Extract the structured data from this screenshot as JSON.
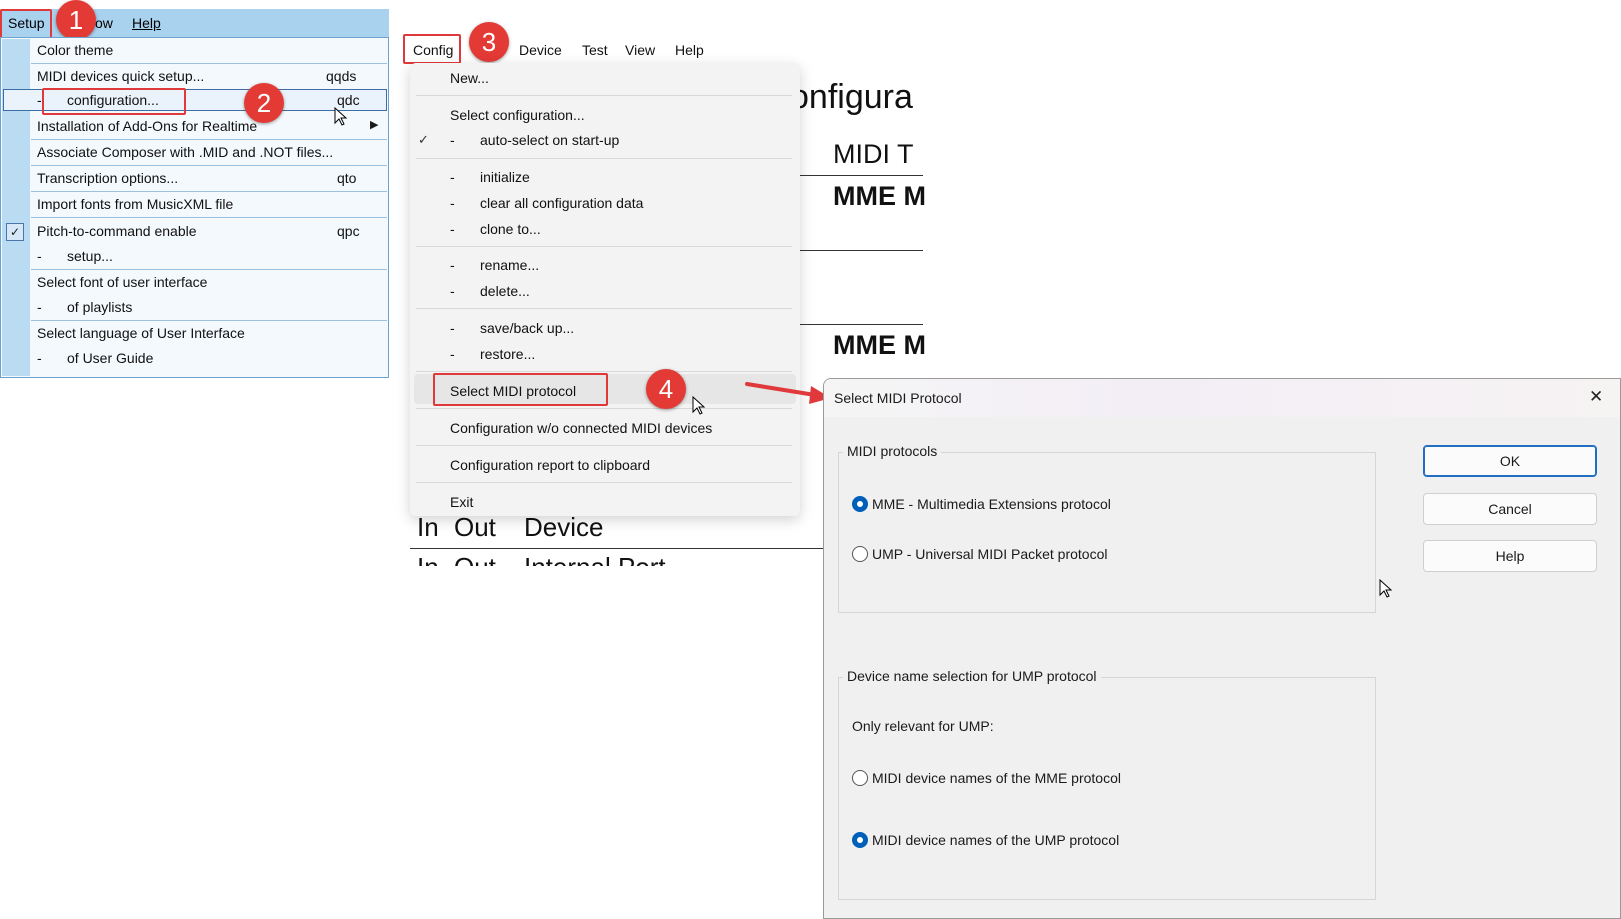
{
  "setup_menubar": {
    "items": [
      "Setup",
      "ow",
      "Help"
    ]
  },
  "setup_menu": {
    "items": [
      {
        "label": "Color theme",
        "shortcut": ""
      },
      {
        "label": "MIDI devices quick setup...",
        "shortcut": "qqds"
      },
      {
        "label": "configuration...",
        "prefix": "-",
        "shortcut": "qdc"
      },
      {
        "label": "Installation of Add-Ons for Realtime",
        "shortcut": ""
      },
      {
        "label": "Associate Composer with .MID and .NOT files...",
        "shortcut": ""
      },
      {
        "label": "Transcription options...",
        "shortcut": "qto"
      },
      {
        "label": "Import fonts from MusicXML file",
        "shortcut": ""
      },
      {
        "label": "Pitch-to-command enable",
        "shortcut": "qpc"
      },
      {
        "label": "setup...",
        "prefix": "-",
        "shortcut": ""
      },
      {
        "label": "Select font of user interface",
        "shortcut": ""
      },
      {
        "label": "of playlists",
        "prefix": "-",
        "shortcut": ""
      },
      {
        "label": "Select language of User Interface",
        "shortcut": ""
      },
      {
        "label": "of User Guide",
        "prefix": "-",
        "shortcut": ""
      }
    ]
  },
  "badges": [
    "1",
    "2",
    "3",
    "4"
  ],
  "config_menubar": {
    "items": [
      "Config",
      "Device",
      "Test",
      "View",
      "Help"
    ]
  },
  "config_menu": {
    "new": "New...",
    "select_configuration": "Select configuration...",
    "auto_select": "auto-select on start-up",
    "initialize": "initialize",
    "clear_all": "clear all configuration data",
    "clone_to": "clone to...",
    "rename": "rename...",
    "delete": "delete...",
    "save_back_up": "save/back up...",
    "restore": "restore...",
    "select_midi_protocol": "Select MIDI protocol",
    "config_without_devices": "Configuration w/o connected MIDI devices",
    "config_report": "Configuration report to clipboard",
    "exit": "Exit",
    "dash": "-"
  },
  "background_doc": {
    "heading": "onfigura",
    "midi_t": "MIDI T",
    "mme_m1": "MME M",
    "mme_m2": "MME M",
    "in": "In",
    "out": "Out",
    "device": "Device",
    "in2": "In",
    "out2": "Out",
    "internal_port": "Internal Port"
  },
  "dialog": {
    "title": "Select MIDI Protocol",
    "group_protocols": "MIDI protocols",
    "option_mme": "MME - Multimedia Extensions protocol",
    "option_ump": "UMP - Universal MIDI Packet protocol",
    "selected_protocol": "MME",
    "group_device_names": "Device name selection for UMP protocol",
    "only_relevant": "Only relevant for UMP:",
    "option_names_mme": "MIDI device names of the MME protocol",
    "option_names_ump": "MIDI device names of the UMP protocol",
    "selected_names": "UMP",
    "ok": "OK",
    "cancel": "Cancel",
    "help": "Help",
    "close_glyph": "✕"
  },
  "colors": {
    "annotation_red": "#e33a36",
    "menubar_blue": "#a9d2ee",
    "accent_blue": "#005fb8"
  }
}
